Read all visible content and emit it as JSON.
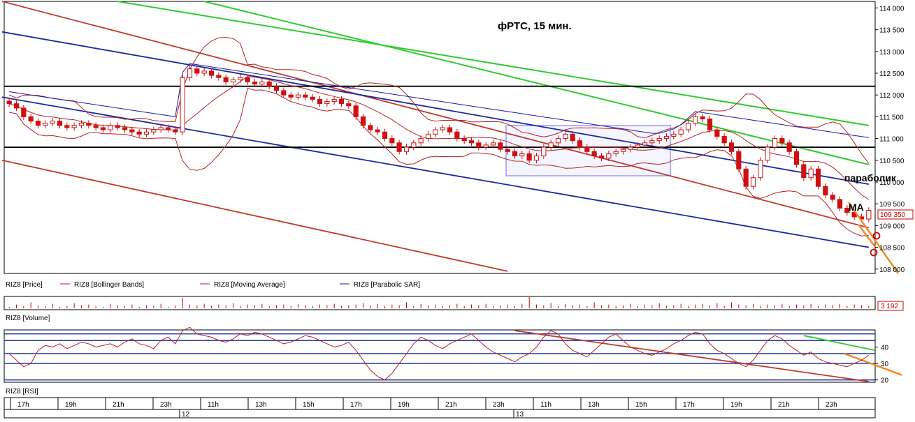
{
  "title": "фРТС, 15 мин.",
  "annotations": {
    "parabolic": "параболик",
    "ma": "МА"
  },
  "price_panel": {
    "legend": [
      {
        "label": "RIZ8 [Price]",
        "color": "#000000"
      },
      {
        "label": "RIZ8 [Bollinger Bands]",
        "color": "#b22222"
      },
      {
        "label": "RIZ8 [Moving Average]",
        "color": "#b22222"
      },
      {
        "label": "RIZ8 [Parabolic SAR]",
        "color": "#1a1aa6"
      }
    ],
    "y_ticks": [
      "114 000",
      "113 500",
      "113 000",
      "112 500",
      "112 000",
      "111 500",
      "111 000",
      "110 500",
      "110 000",
      "109 500",
      "109 000",
      "108 500",
      "108 000"
    ],
    "current_price": "109 350"
  },
  "volume_panel": {
    "label": "RIZ8 [Volume]",
    "current_value": "3 192"
  },
  "rsi_panel": {
    "label": "RIZ8 [RSI]",
    "y_ticks": [
      "40",
      "30",
      "20"
    ]
  },
  "time_axis": {
    "ticks": [
      "17h",
      "19h",
      "21h",
      "23h",
      "11h",
      "13h",
      "15h",
      "17h",
      "19h",
      "21h",
      "23h",
      "11h",
      "13h",
      "15h",
      "17h",
      "19h",
      "21h",
      "23h"
    ],
    "dates": [
      "12",
      "13"
    ]
  },
  "colors": {
    "candle": "#d01010",
    "bollinger": "#b22222",
    "sar": "#1a1aa6",
    "channel_red": "#c0392b",
    "channel_blue": "#1a2aa0",
    "trend_green": "#2ecc2e",
    "forecast": "#f08a2a",
    "rectangle": "#8080ff"
  },
  "chart_data": {
    "type": "candlestick",
    "title": "фРТС, 15 мин.",
    "instrument": "RIZ8",
    "ylim": [
      107900,
      114150
    ],
    "y_tick_values": [
      114000,
      113500,
      113000,
      112500,
      112000,
      111500,
      111000,
      110500,
      110000,
      109500,
      109000,
      108500,
      108000
    ],
    "horizontal_levels": [
      112200,
      110800
    ],
    "last_price": 109350,
    "close_series": [
      111800,
      111700,
      111500,
      111400,
      111300,
      111350,
      111400,
      111300,
      111250,
      111300,
      111350,
      111300,
      111250,
      111200,
      111300,
      111250,
      111200,
      111150,
      111100,
      111150,
      111200,
      111250,
      111200,
      111150,
      112400,
      112600,
      112500,
      112550,
      112450,
      112400,
      112300,
      112350,
      112400,
      112300,
      112250,
      112300,
      112200,
      112100,
      112000,
      111950,
      112000,
      111950,
      111900,
      111800,
      111850,
      111900,
      111800,
      111750,
      111500,
      111300,
      111200,
      111150,
      111000,
      110900,
      110700,
      110800,
      110900,
      111000,
      111100,
      111200,
      111250,
      111150,
      111000,
      110950,
      110900,
      110800,
      110850,
      110900,
      110750,
      110700,
      110600,
      110650,
      110500,
      110600,
      110800,
      110900,
      111000,
      111100,
      110950,
      110800,
      110700,
      110600,
      110550,
      110650,
      110700,
      110750,
      110800,
      110850,
      110900,
      110950,
      111000,
      111050,
      111100,
      111200,
      111350,
      111500,
      111450,
      111200,
      111050,
      110900,
      110700,
      110300,
      109900,
      110100,
      110500,
      110800,
      111000,
      110900,
      110700,
      110400,
      110100,
      110300,
      109900,
      109700,
      109600,
      109400,
      109300,
      109200,
      109150,
      109350
    ],
    "volume_series": [
      2,
      5,
      3,
      8,
      4,
      3,
      6,
      2,
      3,
      7,
      4,
      5,
      3,
      2,
      6,
      4,
      3,
      5,
      2,
      4,
      3,
      6,
      2,
      4,
      14,
      5,
      4,
      6,
      3,
      5,
      4,
      7,
      3,
      5,
      4,
      6,
      3,
      4,
      5,
      3,
      6,
      4,
      3,
      5,
      4,
      6,
      3,
      4,
      5,
      7,
      4,
      6,
      3,
      5,
      4,
      8,
      3,
      6,
      4,
      5,
      3,
      4,
      6,
      3,
      5,
      4,
      6,
      3,
      4,
      5,
      3,
      6,
      15,
      5,
      4,
      7,
      3,
      6,
      4,
      5,
      3,
      8,
      4,
      5,
      3,
      4,
      6,
      3,
      5,
      4,
      7,
      3,
      4,
      6,
      3,
      5,
      6,
      4,
      7,
      3,
      8,
      5,
      4,
      6,
      3,
      5,
      4,
      6,
      3,
      5,
      4,
      6,
      3,
      5,
      4,
      6,
      3,
      5,
      4,
      3
    ],
    "rsi_series": [
      36,
      32,
      28,
      30,
      38,
      41,
      40,
      42,
      39,
      41,
      43,
      42,
      40,
      41,
      42,
      40,
      43,
      45,
      42,
      41,
      39,
      44,
      46,
      42,
      50,
      52,
      48,
      47,
      46,
      44,
      43,
      45,
      48,
      47,
      49,
      48,
      46,
      44,
      42,
      43,
      45,
      47,
      46,
      44,
      42,
      40,
      41,
      43,
      38,
      32,
      26,
      22,
      20,
      24,
      30,
      36,
      42,
      46,
      44,
      41,
      39,
      42,
      44,
      46,
      48,
      44,
      40,
      37,
      35,
      33,
      31,
      34,
      36,
      40,
      46,
      50,
      48,
      42,
      38,
      36,
      34,
      38,
      42,
      46,
      48,
      44,
      40,
      38,
      36,
      35,
      37,
      39,
      42,
      44,
      47,
      49,
      48,
      42,
      38,
      36,
      33,
      30,
      28,
      32,
      38,
      44,
      47,
      45,
      41,
      38,
      35,
      37,
      33,
      31,
      30,
      29,
      28,
      30,
      32,
      35
    ],
    "rsi_ylim": [
      19,
      50
    ],
    "rsi_levels": [
      48,
      44,
      36,
      30,
      20
    ]
  }
}
